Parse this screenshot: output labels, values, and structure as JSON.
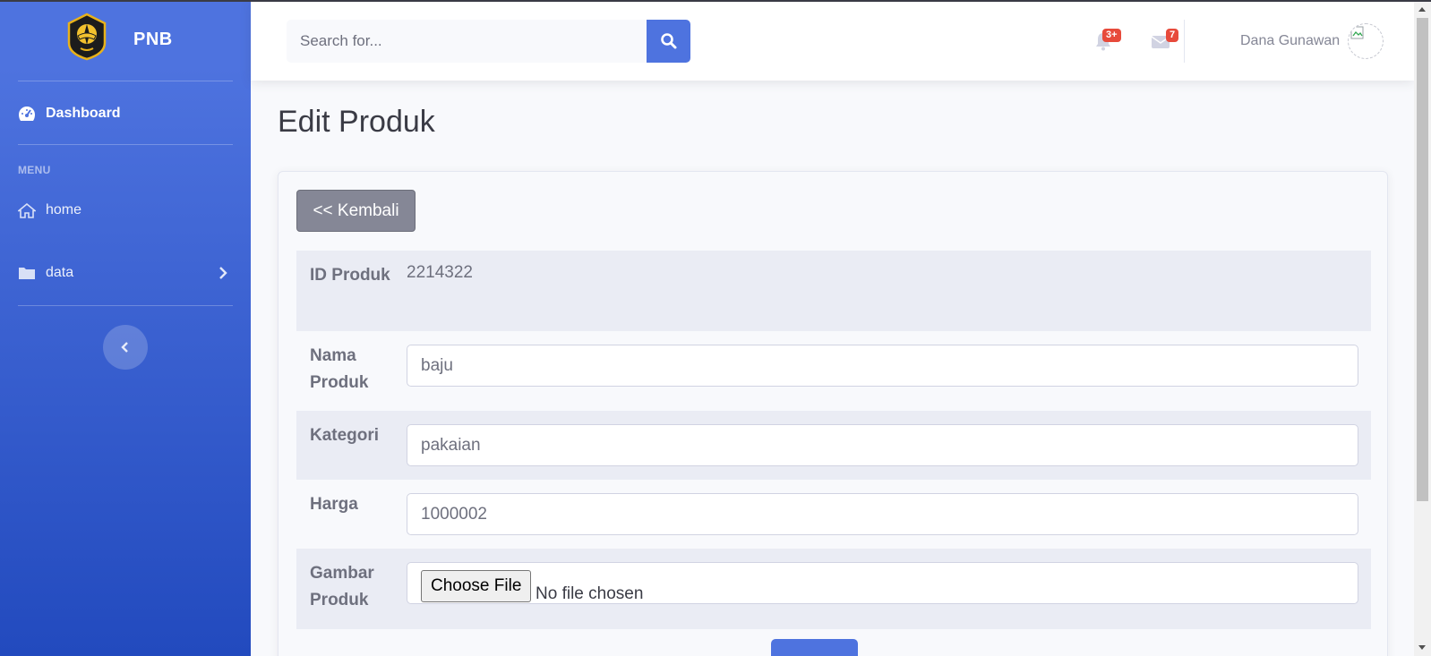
{
  "brand": {
    "name": "PNB",
    "logo_icon": "pnb-emblem-icon"
  },
  "sidebar": {
    "dashboard_label": "Dashboard",
    "menu_heading": "MENU",
    "items": [
      {
        "label": "home",
        "icon": "home-icon"
      },
      {
        "label": "data",
        "icon": "folder-icon"
      }
    ]
  },
  "topbar": {
    "search_placeholder": "Search for...",
    "alerts_badge": "3+",
    "messages_badge": "7",
    "user_name": "Dana Gunawan"
  },
  "page": {
    "title": "Edit Produk",
    "back_label": "<< Kembali",
    "form": {
      "id_label": "ID Produk",
      "id_value": "2214322",
      "nama_label": "Nama Produk",
      "nama_value": "baju",
      "kategori_label": "Kategori",
      "kategori_value": "pakaian",
      "harga_label": "Harga",
      "harga_value": "1000002",
      "gambar_label": "Gambar Produk",
      "file_button_label": "Choose File",
      "file_status": "No file chosen"
    }
  },
  "colors": {
    "primary": "#4e73df",
    "sidebar_gradient_end": "#224abe",
    "danger": "#e74a3b",
    "secondary": "#858796"
  }
}
